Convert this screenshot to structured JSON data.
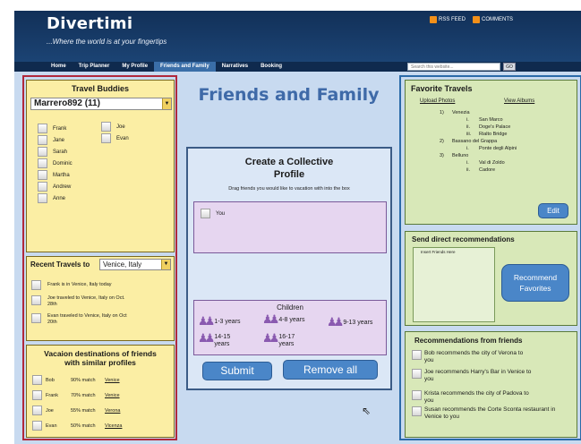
{
  "header": {
    "brand": "Divertimi",
    "tagline": "...Where the world is at your fingertips",
    "rss_feed": "RSS FEED",
    "comments": "COMMENTS",
    "nav": [
      "Home",
      "Trip Planner",
      "My Profile",
      "Friends and Family",
      "Narratives",
      "Booking"
    ],
    "search_placeholder": "Search this website...",
    "go": "GO"
  },
  "page_title": "Friends and Family",
  "travel_buddies": {
    "title": "Travel Buddies",
    "selected_user": "Marrero892 (11)",
    "col1": [
      "Frank",
      "Jane",
      "Sarah",
      "Dominic",
      "Martha",
      "Andrew",
      "Anne"
    ],
    "col2": [
      "Joe",
      "Evan"
    ]
  },
  "recent_travels": {
    "label": "Recent Travels to",
    "selected_city": "Venice, Italy",
    "items": [
      "Frank is in Venice, Italy today",
      "Joe traveled to Venice, Italy on Oct. 28th",
      "Evan traveled to Venice, Italy on Oct 20th"
    ]
  },
  "vacation": {
    "title": "Vacaion destinations of friends with similar profiles",
    "rows": [
      {
        "name": "Bob",
        "match": "90% match",
        "place": "Venice"
      },
      {
        "name": "Frank",
        "match": "70% match",
        "place": "Venice"
      },
      {
        "name": "Joe",
        "match": "55% match",
        "place": "Verona"
      },
      {
        "name": "Evan",
        "match": "50% match",
        "place": "Vicenza"
      }
    ]
  },
  "collective": {
    "title_line1": "Create a Collective",
    "title_line2": "Profile",
    "instruction": "Drag friends you would like to vacation with into the box",
    "drop_you": "You",
    "children_title": "Children",
    "children": [
      "1-3 years",
      "4-8 years",
      "9-13 years",
      "14-15 years",
      "16-17 years"
    ],
    "submit": "Submit",
    "remove_all": "Remove all"
  },
  "favorite_travels": {
    "title": "Favorite Travels",
    "upload": "Upload Photos",
    "view": "View Albums",
    "cities": [
      {
        "num": "1)",
        "name": "Venezia",
        "subs": [
          [
            "i.",
            "San Marco"
          ],
          [
            "ii.",
            "Doge's Palace"
          ],
          [
            "iii.",
            "Rialto Bridge"
          ]
        ]
      },
      {
        "num": "2)",
        "name": "Bassano del Grappa",
        "subs": [
          [
            "i.",
            "Ponte degli Alpini"
          ]
        ]
      },
      {
        "num": "3)",
        "name": "Belluno",
        "subs": [
          [
            "i.",
            "Val di Zoldo"
          ],
          [
            "ii.",
            "Cadore"
          ]
        ]
      }
    ],
    "edit": "Edit"
  },
  "direct_recs": {
    "title": "Send direct recommendations",
    "insert": "Insert Friends Here",
    "button_line1": "Recommend",
    "button_line2": "Favorites"
  },
  "recs_from_friends": {
    "title": "Recommendations from friends",
    "items": [
      "Bob recommends the city of Verona to you",
      "Joe recommends Harry's Bar in Venice to you",
      "Krista recommends the city of Padova to you",
      "Susan recommends the Corte Sconta restaurant in Venice to you"
    ]
  },
  "colors": {
    "header_blue": "#123058",
    "left_border": "#b0283c",
    "yellow_panel": "#fbeea4",
    "green_panel": "#d8e8b8",
    "title_blue": "#3f6aa8",
    "button_blue": "#4a86c8"
  }
}
